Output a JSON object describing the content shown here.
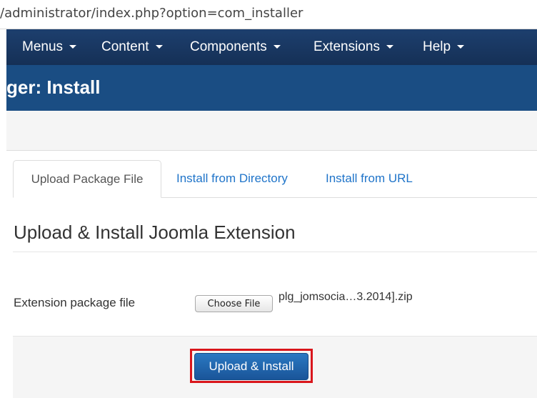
{
  "browser": {
    "url": "/administrator/index.php?option=com_installer"
  },
  "nav": {
    "items": [
      {
        "label": "Menus"
      },
      {
        "label": "Content"
      },
      {
        "label": "Components"
      },
      {
        "label": "Extensions"
      },
      {
        "label": "Help"
      }
    ]
  },
  "header": {
    "title": "ger: Install"
  },
  "tabs": [
    {
      "label": "Upload Package File",
      "active": true
    },
    {
      "label": "Install from Directory",
      "active": false
    },
    {
      "label": "Install from URL",
      "active": false
    }
  ],
  "form": {
    "section_title": "Upload & Install Joomla Extension",
    "field_label": "Extension package file",
    "choose_file_label": "Choose File",
    "file_name": "plg_jomsocia…3.2014].zip",
    "submit_label": "Upload & Install"
  },
  "colors": {
    "navbar": "#1d3f6e",
    "titlebar": "#1a4d83",
    "link": "#1f74c9",
    "button": "#1a5599",
    "highlight": "#d9161c"
  }
}
